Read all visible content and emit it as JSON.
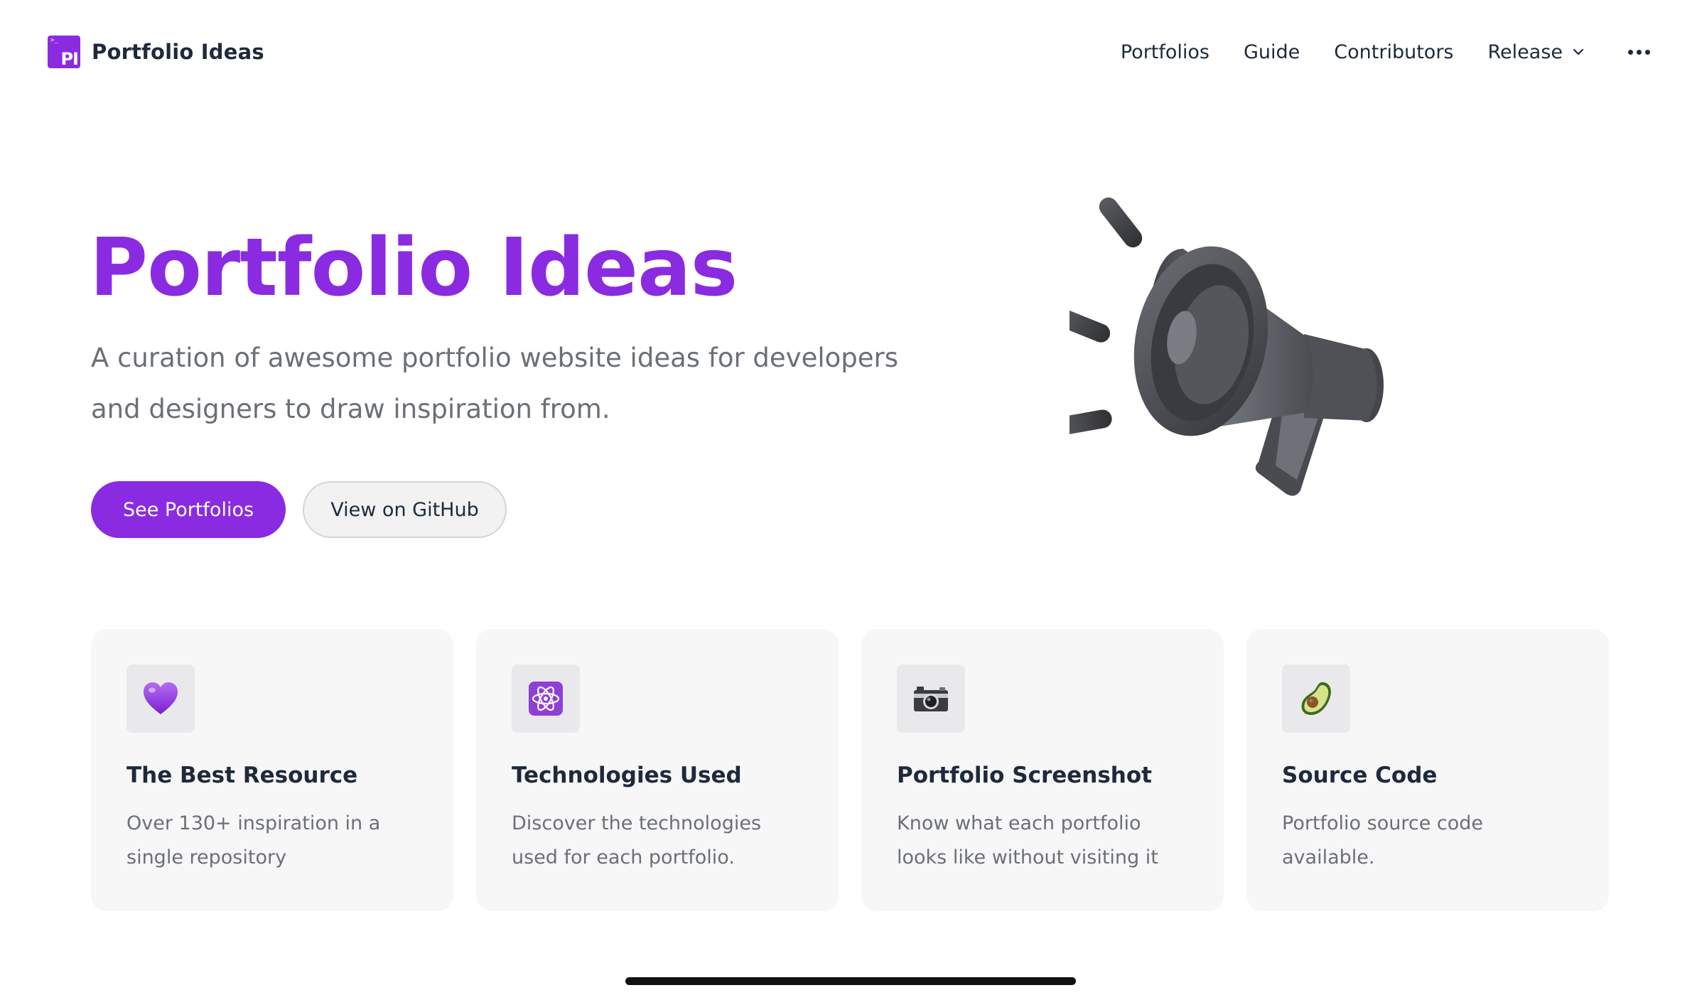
{
  "header": {
    "logo_prompt": ">_",
    "logo_text": "PI",
    "brand": "Portfolio Ideas",
    "nav": [
      "Portfolios",
      "Guide",
      "Contributors",
      "Release"
    ],
    "release_dropdown_icon": "chevron-down-icon",
    "more_icon": "more-horizontal-icon"
  },
  "hero": {
    "title": "Portfolio Ideas",
    "subtitle": "A curation of awesome portfolio website ideas for developers and designers to draw inspiration from.",
    "primary_button": "See Portfolios",
    "secondary_button": "View on GitHub",
    "illustration": "megaphone-icon"
  },
  "features": [
    {
      "icon": "purple-heart-icon",
      "title": "The Best Resource",
      "description": "Over 130+ inspiration in a single repository"
    },
    {
      "icon": "atom-icon",
      "title": "Technologies Used",
      "description": "Discover the technologies used for each portfolio."
    },
    {
      "icon": "camera-icon",
      "title": "Portfolio Screenshot",
      "description": "Know what each portfolio looks like without visiting it"
    },
    {
      "icon": "avocado-icon",
      "title": "Source Code",
      "description": "Portfolio source code available."
    }
  ],
  "colors": {
    "accent": "#8a2be2",
    "text": "#1e2a3b",
    "muted": "#6b6f76",
    "card_bg": "#f7f7f8"
  }
}
